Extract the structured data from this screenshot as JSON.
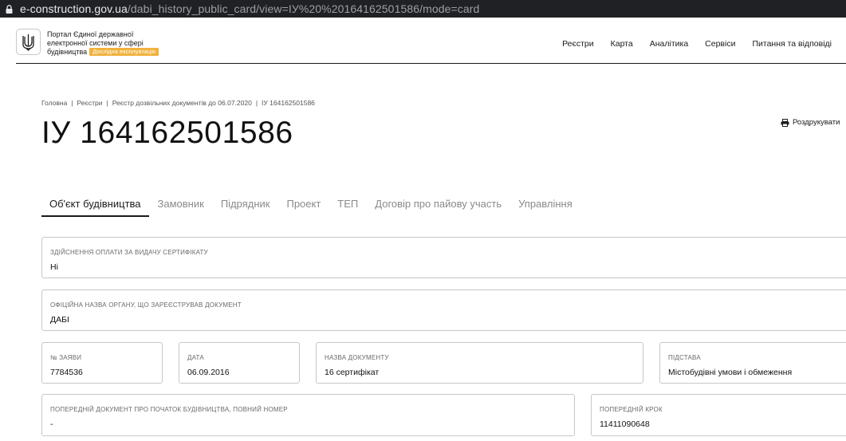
{
  "browser": {
    "url_host": "e-construction.gov.ua",
    "url_path": "/dabi_history_public_card/view=ІУ%20%20164162501586/mode=card"
  },
  "header": {
    "portal_title_lines": [
      "Портал Єдиної державної",
      "електронної системи у сфері",
      "будівництва"
    ],
    "badge": "Дослідна експлуатація",
    "nav": [
      "Реєстри",
      "Карта",
      "Аналітика",
      "Сервіси",
      "Питання та відповіді"
    ]
  },
  "breadcrumb": [
    "Головна",
    "Реєстри",
    "Реєстр дозвільних документів до 06.07.2020",
    "ІУ 164162501586"
  ],
  "page_title": "ІУ 164162501586",
  "print_label": "Роздрукувати",
  "tabs": [
    "Об'єкт будівництва",
    "Замовник",
    "Підрядник",
    "Проект",
    "ТЕП",
    "Договір про пайову участь",
    "Управління"
  ],
  "fields": {
    "payment": {
      "label": "Здійснення оплати за видачу сертифікату",
      "value": "Ні"
    },
    "authority": {
      "label": "Офіційна назва органу, що зареєстрував документ",
      "value": "ДАБІ"
    },
    "application_no": {
      "label": "№ заяви",
      "value": "7784536"
    },
    "date": {
      "label": "Дата",
      "value": "06.09.2016"
    },
    "doc_name": {
      "label": "Назва документу",
      "value": "16 сертифікат"
    },
    "basis": {
      "label": "Підстава",
      "value": "Містобудівні умови і обмеження"
    },
    "prev_doc": {
      "label": "Попередній документ про початок будівництва, повний номер",
      "value": "-"
    },
    "prev_step": {
      "label": "Попередній крок",
      "value": "11411090648"
    }
  },
  "colors": {
    "address_bar": "#202124",
    "badge": "#f0b23c",
    "border": "#c7c7c7"
  }
}
